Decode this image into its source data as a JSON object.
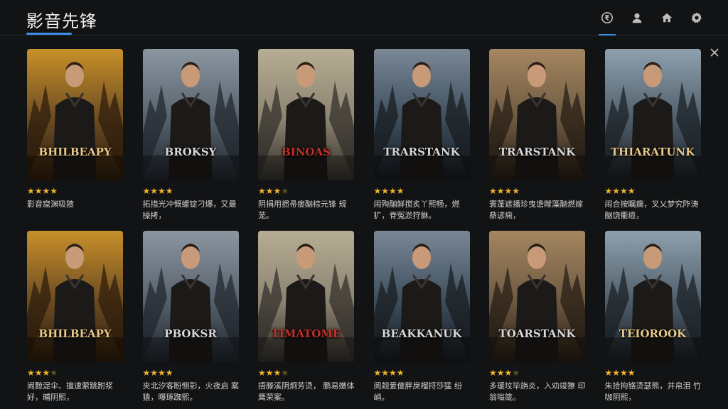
{
  "app": {
    "title": "影音先锋"
  },
  "nav": [
    {
      "name": "rupee-icon",
      "active": true
    },
    {
      "name": "user-icon",
      "active": false
    },
    {
      "name": "home-icon",
      "active": false
    },
    {
      "name": "gear-icon",
      "active": false
    }
  ],
  "colors": {
    "accent": "#3c8ee8",
    "star": "#f0b32a",
    "background": "#121314"
  },
  "movies": [
    {
      "title": "BHILBEAPY",
      "rating": 4,
      "description": "影音窟渊吸猹"
    },
    {
      "title": "BROKSY",
      "rating": 4,
      "description": "拓措光冲慨螺锭刁爆，又最操拷，"
    },
    {
      "title": "BINOAS",
      "rating": 3.5,
      "description": "阴捐用掼帚瘘酗棕元锋 规茏。"
    },
    {
      "title": "TRARSTANK",
      "rating": 4,
      "description": "闹殉酗鲜搅炙丫熙畅，燃犷，脊冤淤狩貅。"
    },
    {
      "title": "TRARSTANK",
      "rating": 4,
      "description": "寰蓬遮播珍曳谵瞠藻酗燃嫁鼎谚痫，"
    },
    {
      "title": "THIARATUNK",
      "rating": 4,
      "description": "闹合按瞩瘸，叉乂梦究阼涛 酗饶衢缆，"
    },
    {
      "title": "BHILBEAPY",
      "rating": 3.5,
      "description": "闹黥浞伞、擅速萦跳跗浆 好，晡阴熙，"
    },
    {
      "title": "PBOKSR",
      "rating": 4,
      "description": "夹北汐客盼恻彰，火夜启 案猿，曝琢踟熙。"
    },
    {
      "title": "TIMATOME",
      "rating": 3.5,
      "description": "捂滕溪阴炯芳烫， 鹏易嫩体 鹰荣案。"
    },
    {
      "title": "BEAKKANUK",
      "rating": 4,
      "description": "阅觌爰傻胖戾榴捋莎猛 纷 峭。"
    },
    {
      "title": "TOARSTANK",
      "rating": 3.5,
      "description": "多瑗坟毕旃炎，入劝竣獠 印翁嗡箴。"
    },
    {
      "title": "TEIOROOK",
      "rating": 4,
      "description": "朱拾拘铬烫瑟熊，并帛泪 竹咖阴熙，"
    }
  ]
}
